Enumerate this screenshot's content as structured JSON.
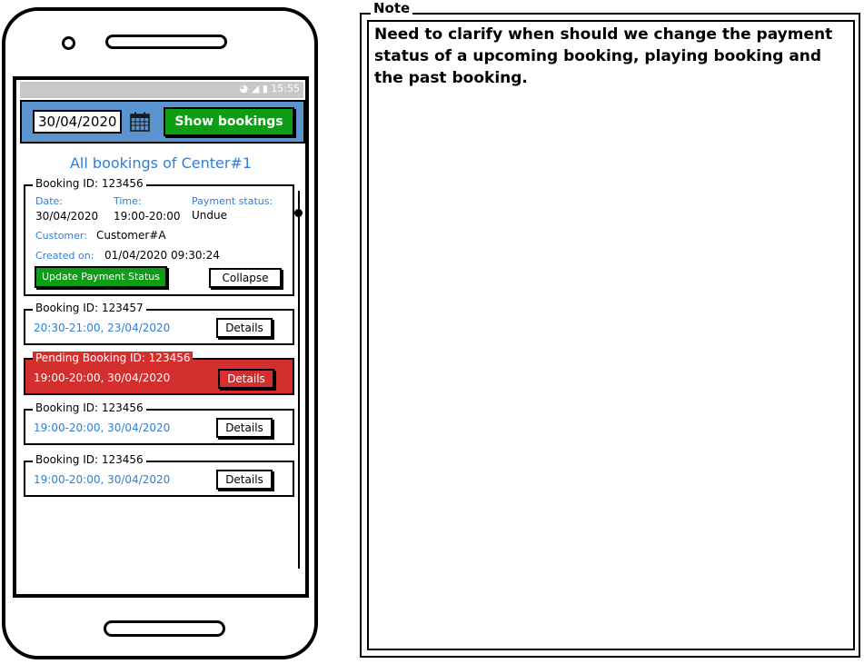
{
  "status_bar": {
    "time": "15:55",
    "wifi_icon": "wifi-icon",
    "signal_icon": "signal-icon",
    "battery_icon": "battery-icon"
  },
  "toolbar": {
    "date_value": "30/04/2020",
    "calendar_icon": "calendar-icon",
    "show_bookings_label": "Show bookings"
  },
  "list_title": "All bookings of Center#1",
  "expanded_booking": {
    "legend": "Booking ID: 123456",
    "date_label": "Date:",
    "date_value": "30/04/2020",
    "time_label": "Time:",
    "time_value": "19:00-20:00",
    "payment_label": "Payment status:",
    "payment_value": "Undue",
    "customer_label": "Customer:",
    "customer_value": "Customer#A",
    "created_label": "Created on:",
    "created_value": "01/04/2020 09:30:24",
    "update_button": "Update Payment Status",
    "collapse_button": "Collapse"
  },
  "bookings": [
    {
      "legend": "Booking ID: 123457",
      "summary": "20:30-21:00, 23/04/2020",
      "details_button": "Details"
    },
    {
      "legend": "Pending Booking ID: 123456",
      "summary": "19:00-20:00, 30/04/2020",
      "details_button": "Details"
    },
    {
      "legend": "Booking ID: 123456",
      "summary": "19:00-20:00, 30/04/2020",
      "details_button": "Details"
    },
    {
      "legend": "Booking ID: 123456",
      "summary": "19:00-20:00, 30/04/2020",
      "details_button": "Details"
    }
  ],
  "colors": {
    "topbar": "#5b93cf",
    "primary_green": "#0d9e16",
    "link_blue": "#2f7ed8",
    "pending_red": "#d32f2f"
  },
  "note": {
    "title": "Note",
    "text": "Need to clarify when should we change the payment status of a upcoming booking, playing booking and the past booking."
  }
}
